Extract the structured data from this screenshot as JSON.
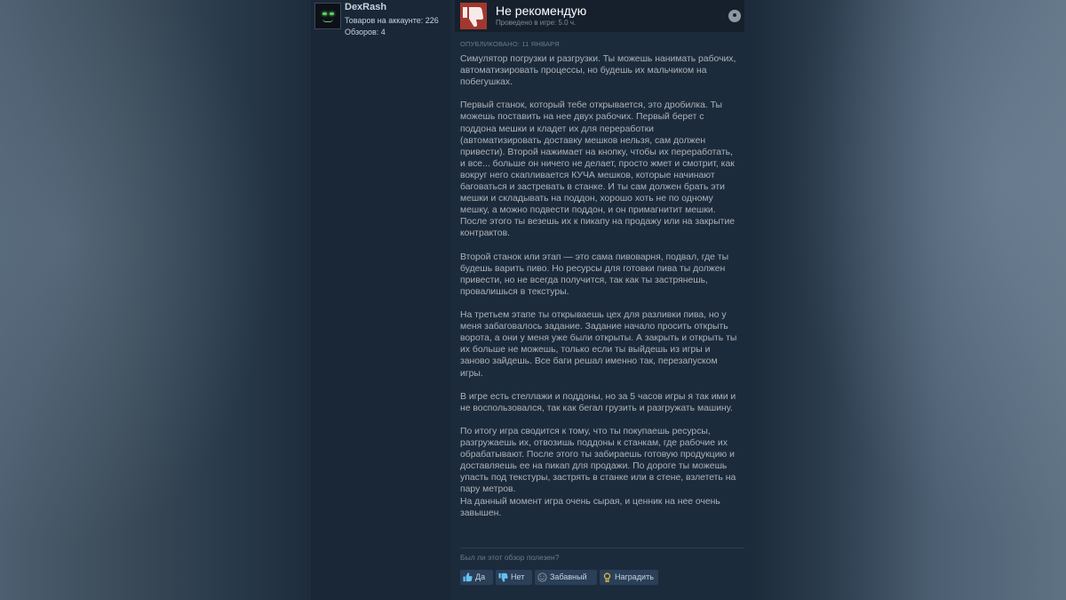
{
  "user": {
    "name": "DexRash",
    "products_label": "Товаров на аккаунте: 226",
    "reviews_label": "Обзоров: 4"
  },
  "review": {
    "verdict": "Не рекомендую",
    "playtime": "Проведено в игре: 5.0 ч.",
    "posted": "ОПУБЛИКОВАНО: 11 ЯНВАРЯ",
    "paragraphs": [
      "Симулятор погрузки и разгрузки. Ты можешь нанимать рабочих,\nавтоматизировать процессы, но будешь их мальчиком на\nпобегушках.",
      "Первый станок, который тебе открывается, это дробилка. Ты\nможешь поставить на нее двух рабочих. Первый берет с\nподдона мешки и кладет их для переработки\n(автоматизировать доставку мешков нельзя, сам должен\nпривести). Второй нажимает на кнопку, чтобы их переработать,\nи все... больше он ничего не делает, просто жмет и смотрит, как\nвокруг него скапливается КУЧА мешков, которые начинают\nбаговаться и застревать в станке. И ты сам должен брать эти\nмешки и складывать на поддон, хорошо хоть не по одному\nмешку, а можно подвести поддон, и он примагнитит мешки.\nПосле этого ты везешь их к пикапу на продажу или на закрытие\nконтрактов.",
      "Второй станок или этап — это сама пивоварня, подвал, где ты\nбудешь варить пиво. Но ресурсы для готовки пива ты должен\nпривести, но не всегда получится, так как ты застрянешь,\nпровалишься в текстуры.",
      "На третьем этапе ты открываешь цех для разливки пива, но у\nменя забаговалось задание. Задание начало просить открыть\nворота, а они у меня уже были открыты. А закрыть и открыть ты\nих больше не можешь, только если ты выйдешь из игры и\nзаново зайдешь. Все баги решал именно так, перезапуском\nигры.",
      "В игре есть стеллажи и поддоны, но за 5 часов игры я так ими и\nне воспользовался, так как бегал грузить и разгружать машину.",
      "По итогу игра сводится к тому, что ты покупаешь ресурсы,\nразгружаешь их, отвозишь поддоны к станкам, где рабочие их\nобрабатывают. После этого ты забираешь готовую продукцию и\nдоставляешь ее на пикап для продажи. По дороге ты можешь\nупасть под текстуры, застрять в станке или в стене, взлететь на\nпару метров.\nНа данный момент игра очень сырая, и ценник на нее очень\nзавышен."
    ],
    "helpful_prompt": "Был ли этот обзор полезен?",
    "buttons": {
      "yes": "Да",
      "no": "Нет",
      "funny": "Забавный",
      "award": "Наградить"
    }
  },
  "icons": {
    "verdict": "thumbs-down-icon",
    "platform": "steam-icon",
    "yes": "thumbs-up-icon",
    "no": "thumbs-down-icon",
    "funny": "smile-icon",
    "award": "award-icon"
  },
  "colors": {
    "verdict_bg": "#a3372e",
    "button_bg": "#2a3f58",
    "accent": "#66c0f4"
  }
}
